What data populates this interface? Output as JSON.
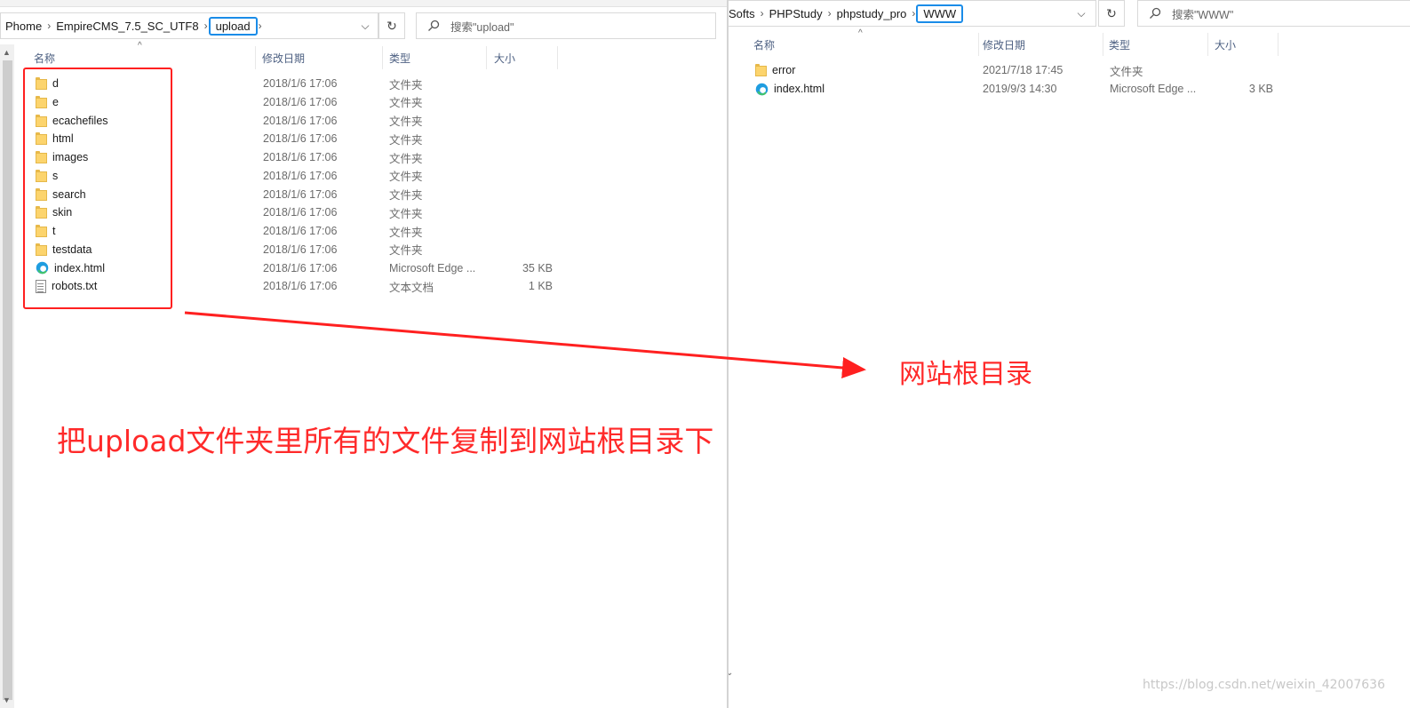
{
  "left": {
    "breadcrumb": [
      "Phome",
      "EmpireCMS_7.5_SC_UTF8",
      "upload"
    ],
    "search_placeholder": "搜索\"upload\"",
    "columns": {
      "name": "名称",
      "date": "修改日期",
      "type": "类型",
      "size": "大小"
    },
    "files": [
      {
        "name": "d",
        "date": "2018/1/6 17:06",
        "type": "文件夹",
        "size": "",
        "icon": "folder-icon"
      },
      {
        "name": "e",
        "date": "2018/1/6 17:06",
        "type": "文件夹",
        "size": "",
        "icon": "folder-icon"
      },
      {
        "name": "ecachefiles",
        "date": "2018/1/6 17:06",
        "type": "文件夹",
        "size": "",
        "icon": "folder-icon"
      },
      {
        "name": "html",
        "date": "2018/1/6 17:06",
        "type": "文件夹",
        "size": "",
        "icon": "folder-icon"
      },
      {
        "name": "images",
        "date": "2018/1/6 17:06",
        "type": "文件夹",
        "size": "",
        "icon": "folder-icon"
      },
      {
        "name": "s",
        "date": "2018/1/6 17:06",
        "type": "文件夹",
        "size": "",
        "icon": "folder-icon"
      },
      {
        "name": "search",
        "date": "2018/1/6 17:06",
        "type": "文件夹",
        "size": "",
        "icon": "folder-icon"
      },
      {
        "name": "skin",
        "date": "2018/1/6 17:06",
        "type": "文件夹",
        "size": "",
        "icon": "folder-icon"
      },
      {
        "name": "t",
        "date": "2018/1/6 17:06",
        "type": "文件夹",
        "size": "",
        "icon": "folder-icon"
      },
      {
        "name": "testdata",
        "date": "2018/1/6 17:06",
        "type": "文件夹",
        "size": "",
        "icon": "folder-icon"
      },
      {
        "name": "index.html",
        "date": "2018/1/6 17:06",
        "type": "Microsoft Edge ...",
        "size": "35 KB",
        "icon": "edge-icon"
      },
      {
        "name": "robots.txt",
        "date": "2018/1/6 17:06",
        "type": "文本文档",
        "size": "1 KB",
        "icon": "text-file-icon"
      }
    ]
  },
  "right": {
    "breadcrumb": [
      "Softs",
      "PHPStudy",
      "phpstudy_pro",
      "WWW"
    ],
    "search_placeholder": "搜索\"WWW\"",
    "columns": {
      "name": "名称",
      "date": "修改日期",
      "type": "类型",
      "size": "大小"
    },
    "files": [
      {
        "name": "error",
        "date": "2021/7/18 17:45",
        "type": "文件夹",
        "size": "",
        "icon": "folder-icon"
      },
      {
        "name": "index.html",
        "date": "2019/9/3 14:30",
        "type": "Microsoft Edge ...",
        "size": "3 KB",
        "icon": "edge-icon"
      }
    ]
  },
  "annotations": {
    "instruction": "把upload文件夹里所有的文件复制到网站根目录下",
    "target": "网站根目录"
  },
  "watermark": "https://blog.csdn.net/weixin_42007636",
  "colors": {
    "annotation_red": "#ff2a2a",
    "highlight_blue": "#1a8ce8"
  }
}
